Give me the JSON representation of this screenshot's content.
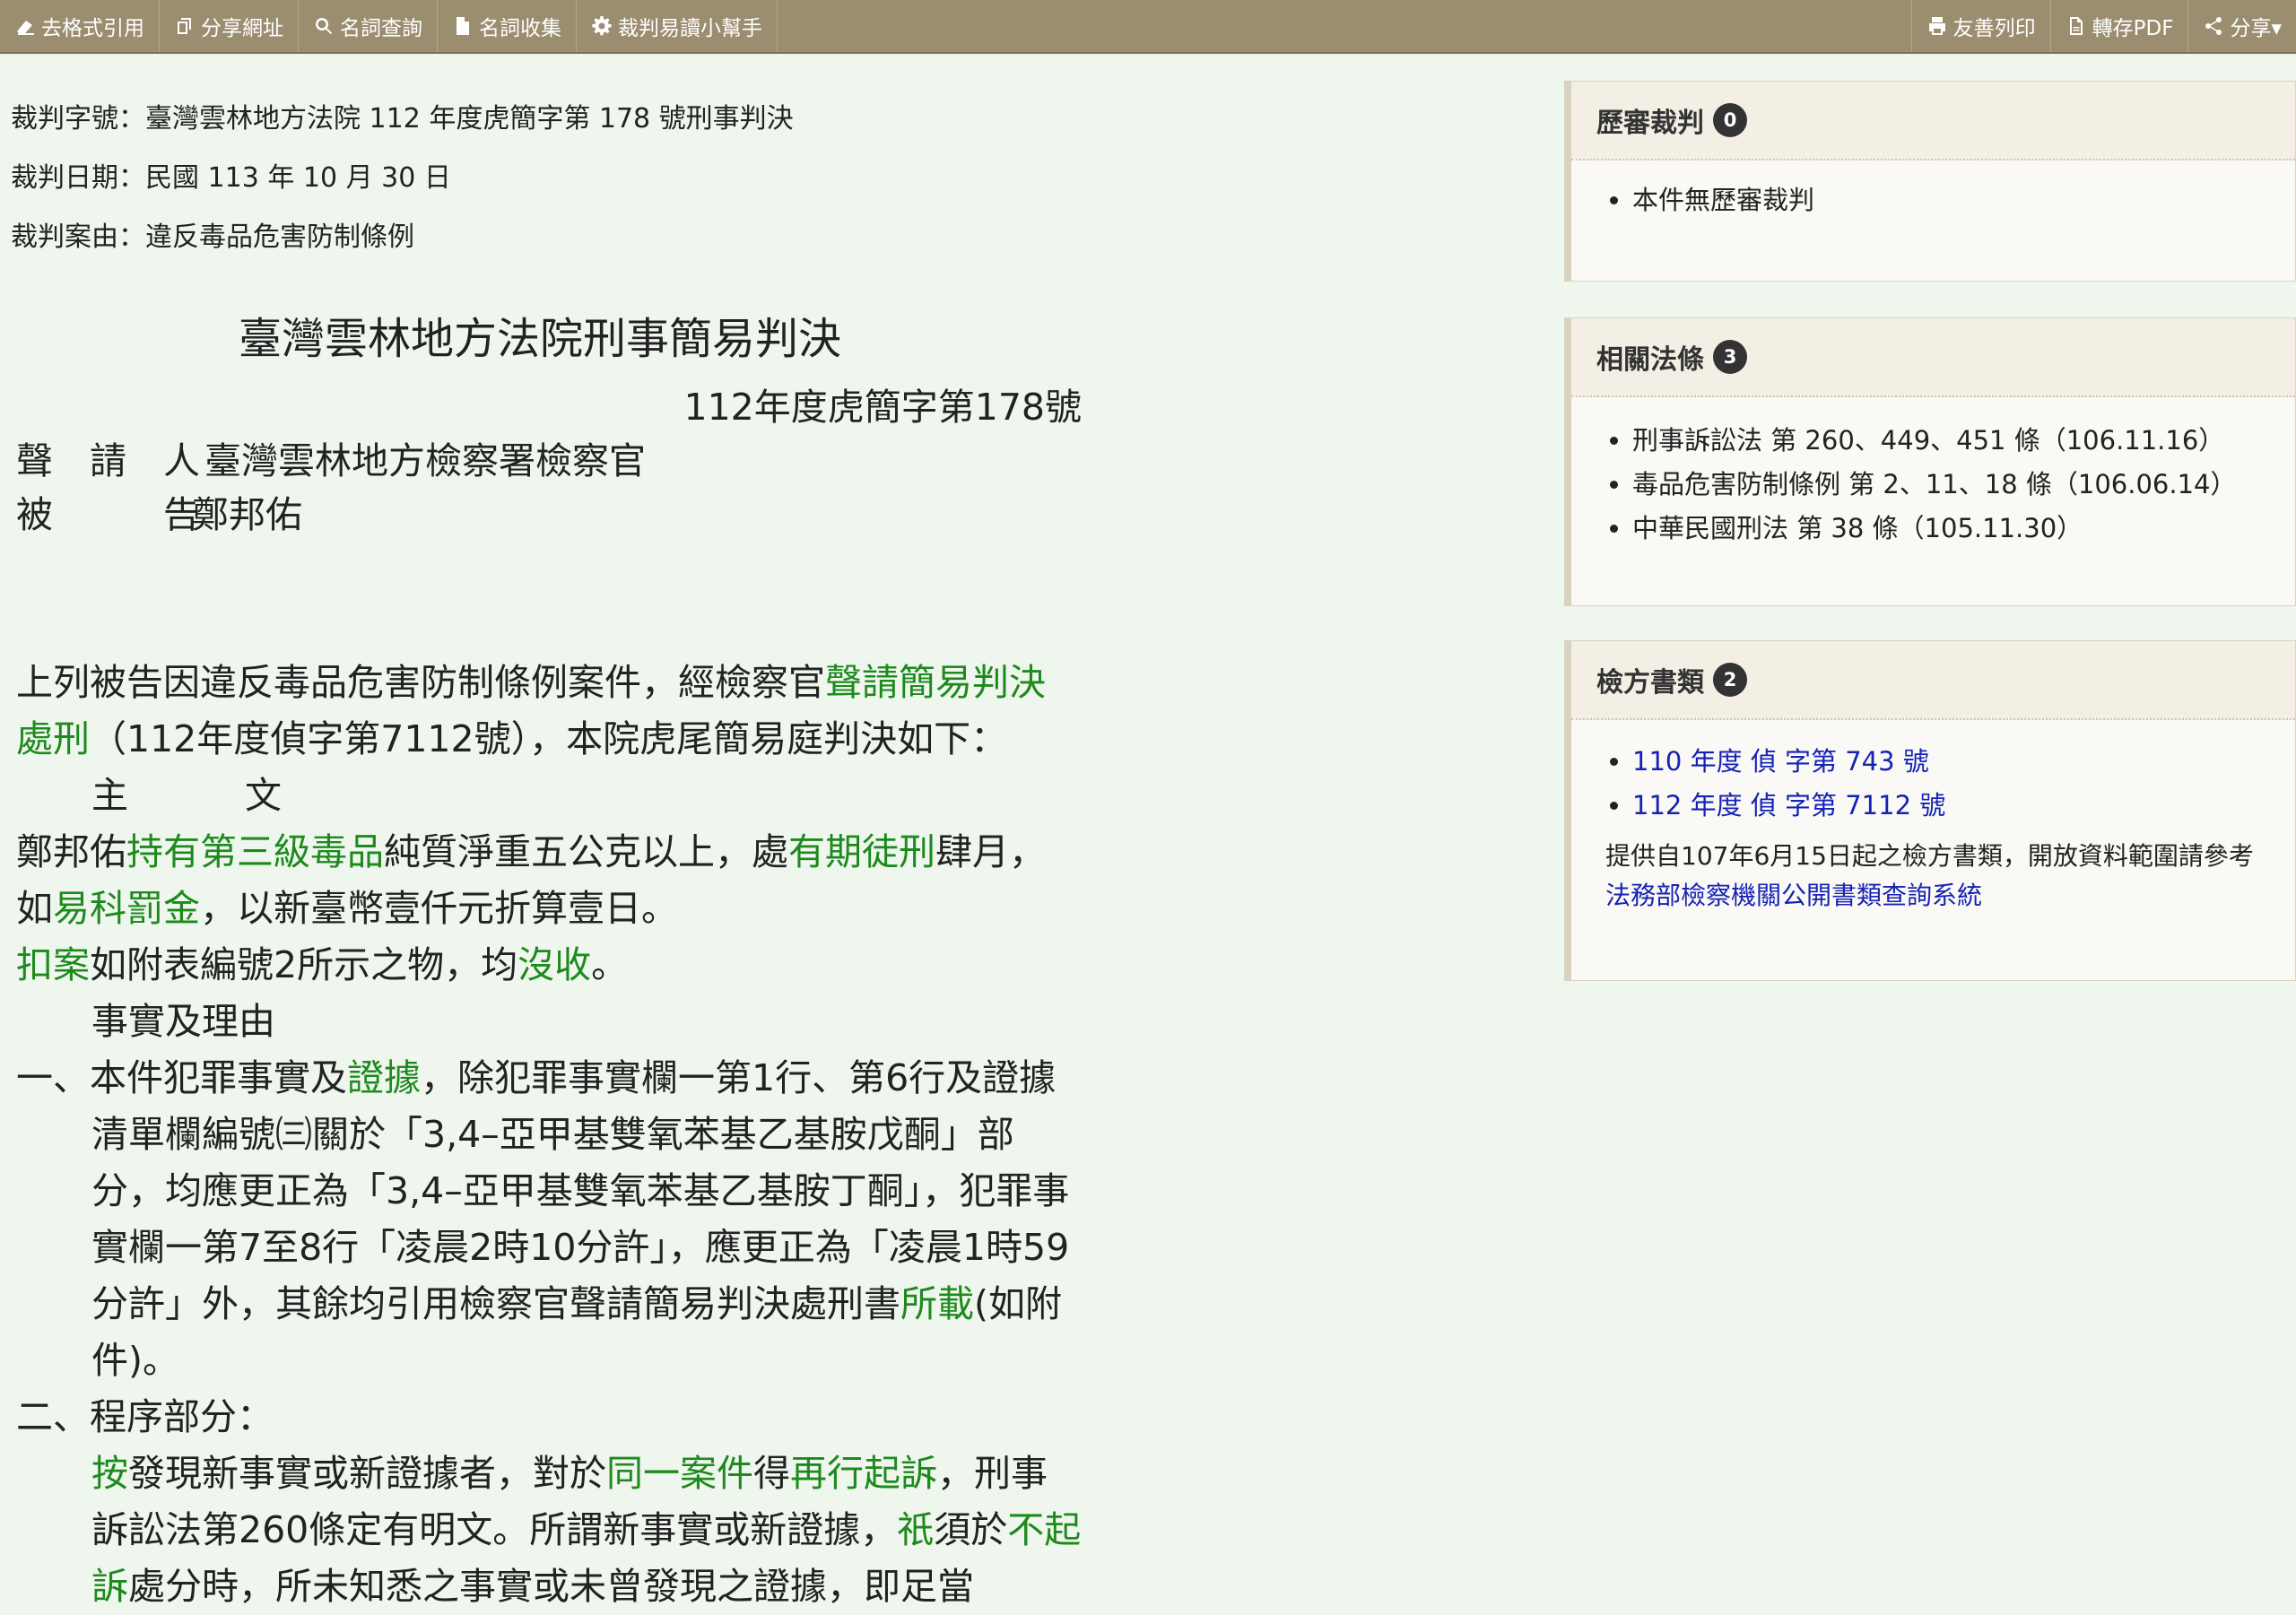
{
  "toolbar": {
    "left": [
      {
        "icon": "eraser-icon",
        "label": "去格式引用"
      },
      {
        "icon": "copy-link-icon",
        "label": "分享網址"
      },
      {
        "icon": "search-icon",
        "label": "名詞查詢"
      },
      {
        "icon": "document-icon",
        "label": "名詞收集"
      },
      {
        "icon": "gear-icon",
        "label": "裁判易讀小幫手"
      }
    ],
    "right": [
      {
        "icon": "print-icon",
        "label": "友善列印"
      },
      {
        "icon": "pdf-icon",
        "label": "轉存PDF"
      },
      {
        "icon": "share-icon",
        "label": "分享▾"
      }
    ]
  },
  "meta": {
    "case_no": "裁判字號：臺灣雲林地方法院 112 年度虎簡字第 178 號刑事判決",
    "date": "裁判日期：民國 113 年 10 月 30 日",
    "cause": "裁判案由：違反毒品危害防制條例"
  },
  "judgment": {
    "court_title": "臺灣雲林地方法院刑事簡易判決",
    "case_no": "112年度虎簡字第178號",
    "party1_label": "聲　請　人",
    "party1_name": "臺灣雲林地方檢察署檢察官",
    "party2_label": "被　　　告",
    "party2_name": "鄭邦佑",
    "para1": [
      "上列被告因違反毒品危害防制條例案件，經檢察官",
      "聲請簡易判決處刑",
      "（112年度偵字第7112號），本院虎尾簡易庭判決如下："
    ],
    "main_heading": [
      "主",
      "文"
    ],
    "main1": [
      "鄭邦佑",
      "持有第三級毒品",
      "純質淨重五公克以上，處",
      "有期徒刑",
      "肆月，如",
      "易科罰金",
      "，以新臺幣壹仟元折算壹日。"
    ],
    "main2": [
      "扣案",
      "如附表編號2所示之物，均",
      "沒收",
      "。"
    ],
    "facts_heading": "事實及理由",
    "item1": [
      "一、本件犯罪事實及",
      "證據",
      "，除犯罪事實欄一第1行、第6行及證據清單欄編號㈢關於「3,4–亞甲基雙氧苯基乙基胺戊酮」部分，均應更正為「3,4–亞甲基雙氧苯基乙基胺丁酮」，犯罪事實欄一第7至8行「凌晨2時10分許」，應更正為「凌晨1時59分許」外，其餘均引用檢察官聲請簡易判決處刑書",
      "所載",
      "(如附件)。"
    ],
    "item2_heading": "二、程序部分：",
    "item2": [
      "按",
      "發現新事實或新證據者，對於",
      "同一案件",
      "得",
      "再行起訴",
      "，刑事訴訟法第260條定有明文。所謂新事實或新證據，",
      "祇",
      "須於",
      "不起訴",
      "處分時，所未知悉之事實或未曾發現之證據，即足當"
    ]
  },
  "panels": {
    "prior": {
      "title": "歷審裁判",
      "count": "0",
      "items": [
        "本件無歷審裁判"
      ]
    },
    "laws": {
      "title": "相關法條",
      "count": "3",
      "items": [
        "刑事訴訟法 第 260、449、451 條（106.11.16）",
        "毒品危害防制條例 第 2、11、18 條（106.06.14）",
        "中華民國刑法 第 38 條（105.11.30）"
      ]
    },
    "prosecutor": {
      "title": "檢方書類",
      "count": "2",
      "items": [
        "110 年度 偵 字第 743 號",
        "112 年度 偵 字第 7112 號"
      ],
      "note_prefix": "提供自107年6月15日起之檢方書類，開放資料範圍請參考",
      "note_link": "法務部檢察機關公開書類查詢系統"
    }
  }
}
